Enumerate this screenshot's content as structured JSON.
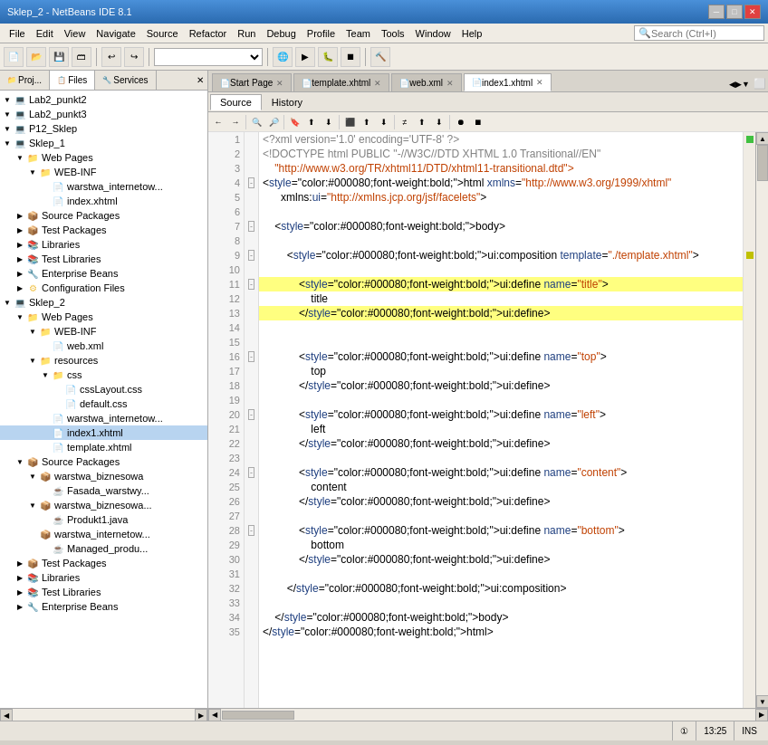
{
  "window": {
    "title": "Sklep_2 - NetBeans IDE 8.1"
  },
  "menu": {
    "items": [
      "File",
      "Edit",
      "View",
      "Navigate",
      "Source",
      "Refactor",
      "Run",
      "Debug",
      "Profile",
      "Team",
      "Tools",
      "Window",
      "Help"
    ]
  },
  "search": {
    "placeholder": "Search (Ctrl+I)"
  },
  "left_panel": {
    "tabs": [
      {
        "label": "Proj...",
        "active": false
      },
      {
        "label": "Files",
        "active": true
      },
      {
        "label": "Services",
        "active": false
      }
    ]
  },
  "editor_tabs": [
    {
      "label": "Start Page",
      "active": false,
      "icon": "🏠"
    },
    {
      "label": "template.xhtml",
      "active": false,
      "icon": "📄"
    },
    {
      "label": "web.xml",
      "active": false,
      "icon": "📄"
    },
    {
      "label": "index1.xhtml",
      "active": true,
      "icon": "📄"
    }
  ],
  "source_tabs": [
    {
      "label": "Source",
      "active": true
    },
    {
      "label": "History",
      "active": false
    }
  ],
  "tree": [
    {
      "indent": 0,
      "toggle": "▼",
      "icon": "💻",
      "label": "Lab2_punkt2",
      "type": "root"
    },
    {
      "indent": 0,
      "toggle": "▼",
      "icon": "💻",
      "label": "Lab2_punkt3",
      "type": "root"
    },
    {
      "indent": 0,
      "toggle": "▼",
      "icon": "💻",
      "label": "P12_Sklep",
      "type": "root"
    },
    {
      "indent": 0,
      "toggle": "▼",
      "icon": "💻",
      "label": "Sklep_1",
      "type": "root"
    },
    {
      "indent": 1,
      "toggle": "▼",
      "icon": "📁",
      "label": "Web Pages",
      "type": "folder"
    },
    {
      "indent": 2,
      "toggle": "▼",
      "icon": "📁",
      "label": "WEB-INF",
      "type": "folder"
    },
    {
      "indent": 3,
      "toggle": " ",
      "icon": "📄",
      "label": "warstwa_internetow...",
      "type": "file"
    },
    {
      "indent": 3,
      "toggle": " ",
      "icon": "📄",
      "label": "index.xhtml",
      "type": "file"
    },
    {
      "indent": 1,
      "toggle": "▶",
      "icon": "📦",
      "label": "Source Packages",
      "type": "pkg"
    },
    {
      "indent": 1,
      "toggle": "▶",
      "icon": "📦",
      "label": "Test Packages",
      "type": "pkg"
    },
    {
      "indent": 1,
      "toggle": "▶",
      "icon": "📚",
      "label": "Libraries",
      "type": "lib"
    },
    {
      "indent": 1,
      "toggle": "▶",
      "icon": "📚",
      "label": "Test Libraries",
      "type": "lib"
    },
    {
      "indent": 1,
      "toggle": "▶",
      "icon": "🔧",
      "label": "Enterprise Beans",
      "type": "folder"
    },
    {
      "indent": 1,
      "toggle": "▶",
      "icon": "⚙",
      "label": "Configuration Files",
      "type": "folder"
    },
    {
      "indent": 0,
      "toggle": "▼",
      "icon": "💻",
      "label": "Sklep_2",
      "type": "root"
    },
    {
      "indent": 1,
      "toggle": "▼",
      "icon": "📁",
      "label": "Web Pages",
      "type": "folder"
    },
    {
      "indent": 2,
      "toggle": "▼",
      "icon": "📁",
      "label": "WEB-INF",
      "type": "folder"
    },
    {
      "indent": 3,
      "toggle": " ",
      "icon": "📄",
      "label": "web.xml",
      "type": "file"
    },
    {
      "indent": 2,
      "toggle": "▼",
      "icon": "📁",
      "label": "resources",
      "type": "folder"
    },
    {
      "indent": 3,
      "toggle": "▼",
      "icon": "📁",
      "label": "css",
      "type": "folder"
    },
    {
      "indent": 4,
      "toggle": " ",
      "icon": "📄",
      "label": "cssLayout.css",
      "type": "file"
    },
    {
      "indent": 4,
      "toggle": " ",
      "icon": "📄",
      "label": "default.css",
      "type": "file"
    },
    {
      "indent": 3,
      "toggle": " ",
      "icon": "📄",
      "label": "warstwa_internetow...",
      "type": "file"
    },
    {
      "indent": 3,
      "toggle": " ",
      "icon": "📄",
      "label": "index1.xhtml",
      "type": "file",
      "selected": true
    },
    {
      "indent": 3,
      "toggle": " ",
      "icon": "📄",
      "label": "template.xhtml",
      "type": "file"
    },
    {
      "indent": 1,
      "toggle": "▼",
      "icon": "📦",
      "label": "Source Packages",
      "type": "pkg"
    },
    {
      "indent": 2,
      "toggle": "▼",
      "icon": "📦",
      "label": "warstwa_biznesowa",
      "type": "pkg"
    },
    {
      "indent": 3,
      "toggle": " ",
      "icon": "☕",
      "label": "Fasada_warstwy...",
      "type": "java"
    },
    {
      "indent": 2,
      "toggle": "▼",
      "icon": "📦",
      "label": "warstwa_biznesowa...",
      "type": "pkg"
    },
    {
      "indent": 3,
      "toggle": " ",
      "icon": "☕",
      "label": "Produkt1.java",
      "type": "java"
    },
    {
      "indent": 2,
      "toggle": " ",
      "icon": "📦",
      "label": "warstwa_internetow...",
      "type": "pkg"
    },
    {
      "indent": 3,
      "toggle": " ",
      "icon": "☕",
      "label": "Managed_produ...",
      "type": "java"
    },
    {
      "indent": 1,
      "toggle": "▶",
      "icon": "📦",
      "label": "Test Packages",
      "type": "pkg"
    },
    {
      "indent": 1,
      "toggle": "▶",
      "icon": "📚",
      "label": "Libraries",
      "type": "lib"
    },
    {
      "indent": 1,
      "toggle": "▶",
      "icon": "📚",
      "label": "Test Libraries",
      "type": "lib"
    },
    {
      "indent": 1,
      "toggle": "▶",
      "icon": "🔧",
      "label": "Enterprise Beans",
      "type": "folder"
    }
  ],
  "code_lines": [
    {
      "num": 1,
      "fold": " ",
      "text": "<?xml version='1.0' encoding='UTF-8' ?>",
      "type": "pi"
    },
    {
      "num": 2,
      "fold": " ",
      "text": "<!DOCTYPE html PUBLIC \"-//W3C//DTD XHTML 1.0 Transitional//EN\"",
      "type": "comment"
    },
    {
      "num": 3,
      "fold": " ",
      "text": "    \"http://www.w3.org/TR/xhtml11/DTD/xhtml11-transitional.dtd\">",
      "type": "string"
    },
    {
      "num": 4,
      "fold": "▼",
      "text": "<html xmlns=\"http://www.w3.org/1999/xhtml\"",
      "type": "tag"
    },
    {
      "num": 5,
      "fold": " ",
      "text": "      xmlns:ui=\"http://xmlns.jcp.org/jsf/facelets\">",
      "type": "tag"
    },
    {
      "num": 6,
      "fold": " ",
      "text": "",
      "type": "blank"
    },
    {
      "num": 7,
      "fold": "▼",
      "text": "    <body>",
      "type": "tag"
    },
    {
      "num": 8,
      "fold": " ",
      "text": "",
      "type": "blank"
    },
    {
      "num": 9,
      "fold": "▼",
      "text": "        <ui:composition template=\"./template.xhtml\">",
      "type": "tag"
    },
    {
      "num": 10,
      "fold": " ",
      "text": "",
      "type": "blank"
    },
    {
      "num": 11,
      "fold": "▼",
      "text": "            <ui:define name=\"title\">",
      "type": "tag_highlight"
    },
    {
      "num": 12,
      "fold": " ",
      "text": "                title",
      "type": "normal"
    },
    {
      "num": 13,
      "fold": " ",
      "text": "            </ui:define>",
      "type": "tag_highlight_end"
    },
    {
      "num": 14,
      "fold": " ",
      "text": "",
      "type": "blank"
    },
    {
      "num": 15,
      "fold": " ",
      "text": "",
      "type": "blank"
    },
    {
      "num": 16,
      "fold": "▼",
      "text": "            <ui:define name=\"top\">",
      "type": "tag"
    },
    {
      "num": 17,
      "fold": " ",
      "text": "                top",
      "type": "normal"
    },
    {
      "num": 18,
      "fold": " ",
      "text": "            </ui:define>",
      "type": "tag"
    },
    {
      "num": 19,
      "fold": " ",
      "text": "",
      "type": "blank"
    },
    {
      "num": 20,
      "fold": "▼",
      "text": "            <ui:define name=\"left\">",
      "type": "tag"
    },
    {
      "num": 21,
      "fold": " ",
      "text": "                left",
      "type": "normal"
    },
    {
      "num": 22,
      "fold": " ",
      "text": "            </ui:define>",
      "type": "tag"
    },
    {
      "num": 23,
      "fold": " ",
      "text": "",
      "type": "blank"
    },
    {
      "num": 24,
      "fold": "▼",
      "text": "            <ui:define name=\"content\">",
      "type": "tag"
    },
    {
      "num": 25,
      "fold": " ",
      "text": "                content",
      "type": "normal"
    },
    {
      "num": 26,
      "fold": " ",
      "text": "            </ui:define>",
      "type": "tag"
    },
    {
      "num": 27,
      "fold": " ",
      "text": "",
      "type": "blank"
    },
    {
      "num": 28,
      "fold": "▼",
      "text": "            <ui:define name=\"bottom\">",
      "type": "tag"
    },
    {
      "num": 29,
      "fold": " ",
      "text": "                bottom",
      "type": "normal"
    },
    {
      "num": 30,
      "fold": " ",
      "text": "            </ui:define>",
      "type": "tag"
    },
    {
      "num": 31,
      "fold": " ",
      "text": "",
      "type": "blank"
    },
    {
      "num": 32,
      "fold": " ",
      "text": "        </ui:composition>",
      "type": "tag"
    },
    {
      "num": 33,
      "fold": " ",
      "text": "",
      "type": "blank"
    },
    {
      "num": 34,
      "fold": " ",
      "text": "    </body>",
      "type": "tag"
    },
    {
      "num": 35,
      "fold": " ",
      "text": "</html>",
      "type": "tag"
    }
  ],
  "status": {
    "notification": "①",
    "time": "13:25",
    "mode": "INS"
  }
}
